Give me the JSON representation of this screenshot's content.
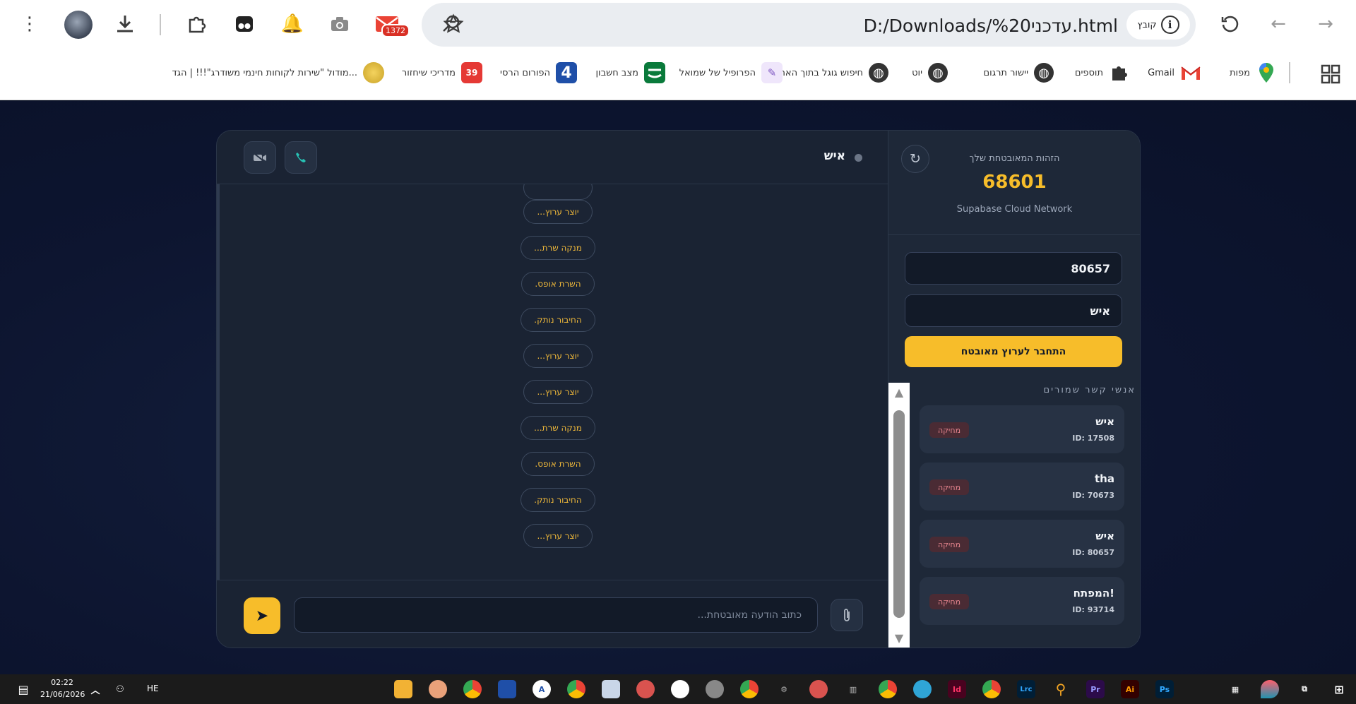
{
  "browser": {
    "url": "D:/Downloads/%20עדכני.html",
    "site_info_label": "קובץ",
    "gmail_badge_count": "1372",
    "bookmarks": [
      {
        "label": "מפות",
        "icon": "maps-pin-icon",
        "color": "#34a853"
      },
      {
        "label": "Gmail",
        "icon": "gmail-icon",
        "color": "#ea4335"
      },
      {
        "label": "תוספים",
        "icon": "puzzle-icon",
        "color": "#333333"
      },
      {
        "label": "יישור תרגום",
        "icon": "globe-icon",
        "color": "#333333"
      },
      {
        "label": "יוט",
        "icon": "globe-icon",
        "color": "#333333"
      },
      {
        "label": "חיפוש גוגל בתוך האתר",
        "icon": "globe-icon",
        "color": "#333333"
      },
      {
        "label": "הפרופיל של שמואל",
        "icon": "feather-icon",
        "color": "#7e57c2"
      },
      {
        "label": "מצב חשבון",
        "icon": "bank-logo-icon",
        "color": "#0a7a3b"
      },
      {
        "label": "הפורום הרסי",
        "icon": "forum-logo-icon",
        "color": "#1f4fa8"
      },
      {
        "label": "מדריכי שיחזור",
        "icon": "badge-39-icon",
        "color": "#e53935"
      },
      {
        "label": "מודול \"שירות לקוחות חינמי משודרג\"!!! | הגד...",
        "icon": "module-logo-icon",
        "color": "#c9a227"
      }
    ]
  },
  "identity": {
    "label": "הזהות המאובטחת שלך",
    "value": "68601",
    "network": "Supabase Cloud Network"
  },
  "form": {
    "target_id_value": "80657",
    "name_value": "איש",
    "connect_label": "התחבר לערוץ מאובטח"
  },
  "contacts": {
    "title": "אנשי קשר שמורים",
    "delete_label": "מחיקה",
    "items": [
      {
        "name": "איש",
        "id": "ID: 17508"
      },
      {
        "name": "tha",
        "id": "ID: 70673"
      },
      {
        "name": "איש",
        "id": "ID: 80657"
      },
      {
        "name": "המפתח!",
        "id": "ID: 93714"
      }
    ]
  },
  "chat": {
    "peer_name": "איש",
    "messages": [
      "יוצר ערוץ...",
      "מנקה שרת...",
      "השרת אופס.",
      "החיבור נותק.",
      "יוצר ערוץ...",
      "יוצר ערוץ...",
      "מנקה שרת...",
      "השרת אופס.",
      "החיבור נותק.",
      "יוצר ערוץ..."
    ],
    "input_placeholder": "כתוב הודעה מאובטחת...",
    "send_glyph": "➤"
  },
  "taskbar": {
    "time": "02:22",
    "date": "21/06/2026",
    "language": "HE",
    "apps": [
      "Id",
      "Lrc",
      "Pr",
      "Ai",
      "Ps"
    ]
  },
  "colors": {
    "accent": "#f7bd2a",
    "card_bg": "#1a2333",
    "delete_text": "#e5848d"
  }
}
